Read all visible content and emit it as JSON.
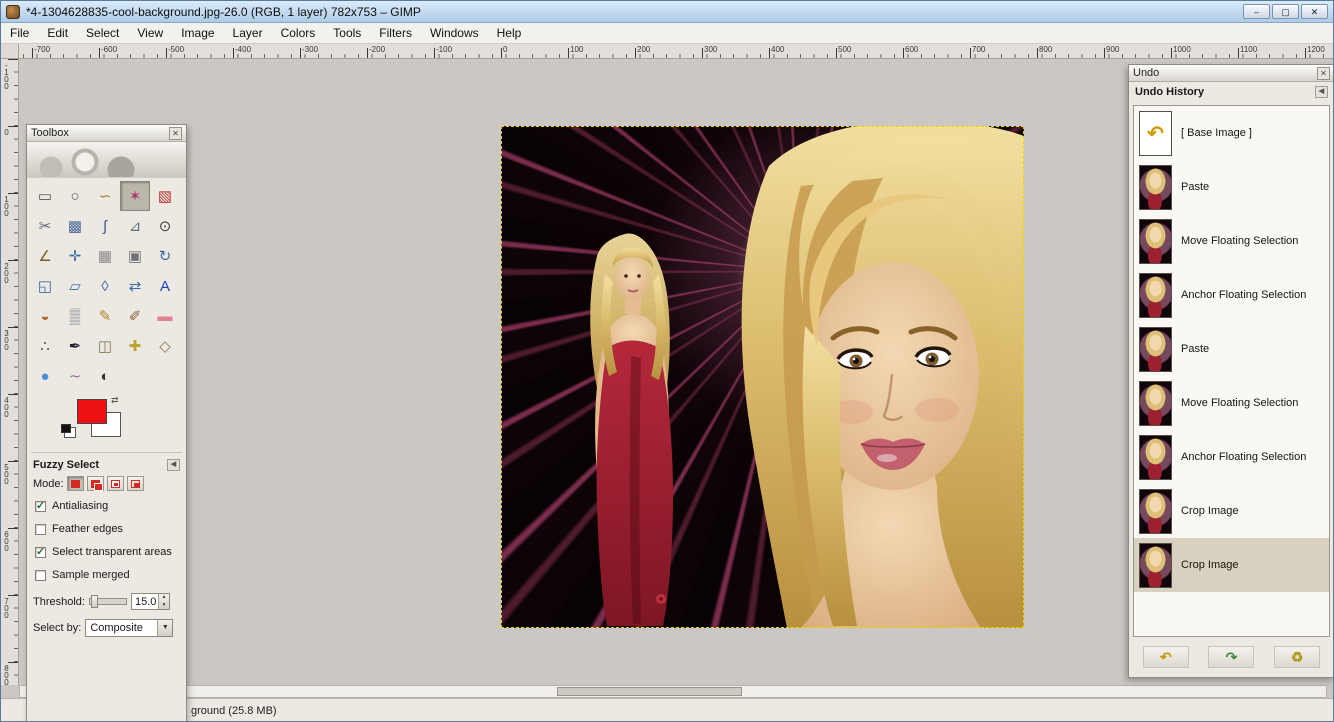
{
  "window": {
    "title": "*4-1304628835-cool-background.jpg-26.0 (RGB, 1 layer) 782x753 – GIMP"
  },
  "icons": {
    "minimize": "–",
    "maximize": "▢",
    "window_close": "✕",
    "close": "✕",
    "panel_menu": "◀",
    "combo_arrow": "▼",
    "spin_up": "▲",
    "spin_down": "▼",
    "check": "✓",
    "swap_colors": "⇄",
    "base_image_arrow": "↶"
  },
  "menu": {
    "items": [
      "File",
      "Edit",
      "Select",
      "View",
      "Image",
      "Layer",
      "Colors",
      "Tools",
      "Filters",
      "Windows",
      "Help"
    ]
  },
  "rulers": {
    "horizontal_labels": [
      "-700",
      "-600",
      "-500",
      "-400",
      "-300",
      "-200",
      "-100",
      "0",
      "100",
      "200",
      "300",
      "400",
      "500",
      "600",
      "700",
      "800",
      "900",
      "1000",
      "1100",
      "1200"
    ],
    "vertical_labels": [
      "-100",
      "0",
      "100",
      "200",
      "300",
      "400",
      "500",
      "600",
      "700",
      "800"
    ]
  },
  "toolbox": {
    "title": "Toolbox",
    "colors": {
      "foreground": "#ee1212",
      "background": "#ffffff"
    },
    "tools": [
      {
        "name": "rectangle-select",
        "glyph": "▭",
        "color": "#555555",
        "active": false
      },
      {
        "name": "ellipse-select",
        "glyph": "○",
        "color": "#555555",
        "active": false
      },
      {
        "name": "free-select",
        "glyph": "∽",
        "color": "#a87c28",
        "active": false
      },
      {
        "name": "fuzzy-select",
        "glyph": "✶",
        "color": "#b03878",
        "active": true
      },
      {
        "name": "select-by-color",
        "glyph": "▧",
        "color": "#c03030",
        "active": false
      },
      {
        "name": "scissors-select",
        "glyph": "✂",
        "color": "#5a6a7a",
        "active": false
      },
      {
        "name": "foreground-select",
        "glyph": "▩",
        "color": "#4a6a9a",
        "active": false
      },
      {
        "name": "paths",
        "glyph": "ʃ",
        "color": "#3a5a9a",
        "active": false
      },
      {
        "name": "color-picker",
        "glyph": "⊿",
        "color": "#607080",
        "active": false
      },
      {
        "name": "zoom",
        "glyph": "⊙",
        "color": "#404040",
        "active": false
      },
      {
        "name": "measure",
        "glyph": "∠",
        "color": "#806020",
        "active": false
      },
      {
        "name": "move",
        "glyph": "✛",
        "color": "#3a6aaa",
        "active": false
      },
      {
        "name": "align",
        "glyph": "▦",
        "color": "#888888",
        "active": false
      },
      {
        "name": "crop",
        "glyph": "▣",
        "color": "#707078",
        "active": false
      },
      {
        "name": "rotate",
        "glyph": "↻",
        "color": "#3a6aaa",
        "active": false
      },
      {
        "name": "scale",
        "glyph": "◱",
        "color": "#3a6aaa",
        "active": false
      },
      {
        "name": "shear",
        "glyph": "▱",
        "color": "#3a6aaa",
        "active": false
      },
      {
        "name": "perspective",
        "glyph": "◊",
        "color": "#3a6aaa",
        "active": false
      },
      {
        "name": "flip",
        "glyph": "⇄",
        "color": "#3a6aaa",
        "active": false
      },
      {
        "name": "text",
        "glyph": "A",
        "color": "#2244bb",
        "active": false
      },
      {
        "name": "bucket-fill",
        "glyph": "◒",
        "color": "#b06a2a",
        "active": false
      },
      {
        "name": "blend",
        "glyph": "▒",
        "color": "#607080",
        "active": false
      },
      {
        "name": "pencil",
        "glyph": "✎",
        "color": "#b08030",
        "active": false
      },
      {
        "name": "paintbrush",
        "glyph": "✐",
        "color": "#8a5a2a",
        "active": false
      },
      {
        "name": "eraser",
        "glyph": "▬",
        "color": "#e08090",
        "active": false
      },
      {
        "name": "airbrush",
        "glyph": "∴",
        "color": "#555555",
        "active": false
      },
      {
        "name": "ink",
        "glyph": "✒",
        "color": "#222233",
        "active": false
      },
      {
        "name": "clone",
        "glyph": "◫",
        "color": "#8a7a5a",
        "active": false
      },
      {
        "name": "heal",
        "glyph": "✚",
        "color": "#c0a030",
        "active": false
      },
      {
        "name": "perspective-clone",
        "glyph": "◇",
        "color": "#8a7a5a",
        "active": false
      },
      {
        "name": "blur-sharpen",
        "glyph": "●",
        "color": "#4a90d8",
        "active": false
      },
      {
        "name": "smudge",
        "glyph": "∼",
        "color": "#9a6a9a",
        "active": false
      },
      {
        "name": "dodge-burn",
        "glyph": "◐",
        "color": "#333333",
        "active": false
      }
    ],
    "tool_options": {
      "title": "Fuzzy Select",
      "mode_label": "Mode:",
      "modes": [
        "replace",
        "add",
        "subtract",
        "intersect"
      ],
      "checkboxes": [
        {
          "label": "Antialiasing",
          "checked": true
        },
        {
          "label": "Feather edges",
          "checked": false
        },
        {
          "label": "Select transparent areas",
          "checked": true
        },
        {
          "label": "Sample merged",
          "checked": false
        }
      ],
      "threshold_label": "Threshold:",
      "threshold_value": "15.0",
      "select_by_label": "Select by:",
      "select_by_value": "Composite"
    }
  },
  "undo_panel": {
    "title": "Undo",
    "header": "Undo History",
    "items": [
      {
        "label": "[ Base Image ]",
        "thumb": "arrow",
        "selected": false
      },
      {
        "label": "Paste",
        "thumb": "image",
        "selected": false
      },
      {
        "label": "Move Floating Selection",
        "thumb": "image",
        "selected": false
      },
      {
        "label": "Anchor Floating Selection",
        "thumb": "image",
        "selected": false
      },
      {
        "label": "Paste",
        "thumb": "image",
        "selected": false
      },
      {
        "label": "Move Floating Selection",
        "thumb": "image",
        "selected": false
      },
      {
        "label": "Anchor Floating Selection",
        "thumb": "image",
        "selected": false
      },
      {
        "label": "Crop Image",
        "thumb": "image",
        "selected": false
      },
      {
        "label": "Crop Image",
        "thumb": "image",
        "selected": true
      }
    ],
    "buttons": [
      {
        "name": "undo-button",
        "glyph": "↶",
        "color": "#c8960c"
      },
      {
        "name": "redo-button",
        "glyph": "↷",
        "color": "#3f8f3f"
      },
      {
        "name": "clear-undo-history-button",
        "glyph": "♻",
        "color": "#b09a20"
      }
    ]
  },
  "status_bar": {
    "text": "ground (25.8 MB)"
  }
}
